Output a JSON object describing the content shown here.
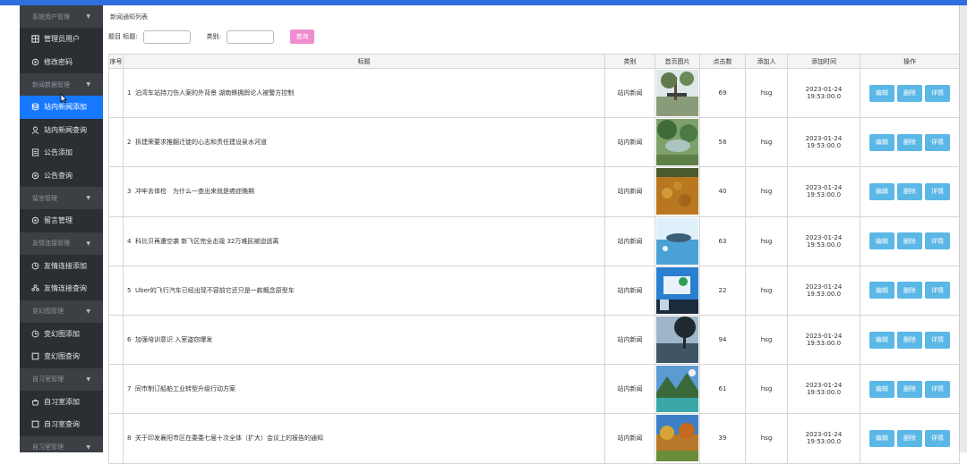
{
  "sidebar": {
    "groups": [
      {
        "header": "系统用户管理",
        "items": [
          {
            "label": "管理员用户",
            "icon": "grid-icon"
          },
          {
            "label": "修改密码",
            "icon": "settings-icon"
          }
        ]
      },
      {
        "header": "新闻数据管理",
        "items": [
          {
            "label": "站内新闻添加",
            "icon": "database-icon",
            "active": true
          },
          {
            "label": "站内新闻查询",
            "icon": "user-icon"
          },
          {
            "label": "公告添加",
            "icon": "document-icon"
          },
          {
            "label": "公告查询",
            "icon": "settings-icon"
          }
        ]
      },
      {
        "header": "留言管理",
        "items": [
          {
            "label": "留言管理",
            "icon": "settings-icon"
          }
        ]
      },
      {
        "header": "友情连接管理",
        "items": [
          {
            "label": "友情连接添加",
            "icon": "clock-icon"
          },
          {
            "label": "友情连接查询",
            "icon": "people-icon"
          }
        ]
      },
      {
        "header": "变幻图管理",
        "items": [
          {
            "label": "变幻图添加",
            "icon": "clock-icon"
          },
          {
            "label": "变幻图查询",
            "icon": "square-icon"
          }
        ]
      },
      {
        "header": "自习室管理",
        "items": [
          {
            "label": "自习室添加",
            "icon": "bag-icon"
          },
          {
            "label": "自习室查询",
            "icon": "square-icon"
          }
        ]
      },
      {
        "header": "自习室管理",
        "items": []
      }
    ]
  },
  "main": {
    "breadcrumb": "新闻通知列表",
    "search": {
      "title_label": "题目 标题:",
      "title_value": "",
      "category_label": "类别:",
      "category_value": "",
      "button": "查询"
    },
    "table": {
      "columns": [
        "序号",
        "标题",
        "类别",
        "首页图片",
        "点击数",
        "添加人",
        "添加时间",
        "操作"
      ],
      "actions": [
        "编辑",
        "删除",
        "详情"
      ],
      "rows": [
        {
          "idx": "1",
          "title": "泊湾车站持刀伤人案的外背景 湖南蜂拥舆论人被警方控制",
          "category": "站内新闻",
          "clicks": "69",
          "author": "hsg",
          "time": "2023-01-24 19:53:00.0"
        },
        {
          "idx": "2",
          "title": "拆建荣要求推翻迁徙的心志和责任建设泉水河道",
          "category": "站内新闻",
          "clicks": "58",
          "author": "hsg",
          "time": "2023-01-24 19:53:00.0"
        },
        {
          "idx": "3",
          "title": "冲牢去体检　为什么一查出来就是癌症晚期",
          "category": "站内新闻",
          "clicks": "40",
          "author": "hsg",
          "time": "2023-01-24 19:53:00.0"
        },
        {
          "idx": "4",
          "title": "科比贝再遭空袭 新飞区完全击毁 32万难民被迫逃离",
          "category": "站内新闻",
          "clicks": "63",
          "author": "hsg",
          "time": "2023-01-24 19:53:00.0"
        },
        {
          "idx": "5",
          "title": "Uber的飞行汽车已经出现不容前它还只是一款概念原型车",
          "category": "站内新闻",
          "clicks": "22",
          "author": "hsg",
          "time": "2023-01-24 19:53:00.0"
        },
        {
          "idx": "6",
          "title": "加强培训意识 入室盗窃爆发",
          "category": "站内新闻",
          "clicks": "94",
          "author": "hsg",
          "time": "2023-01-24 19:53:00.0"
        },
        {
          "idx": "7",
          "title": "同市制订船舶工业转型升级行动方案",
          "category": "站内新闻",
          "clicks": "61",
          "author": "hsg",
          "time": "2023-01-24 19:53:00.0"
        },
        {
          "idx": "8",
          "title": "关于印发襄阳市区在委委七届十次全体（扩大）会议上的报告的通知",
          "category": "站内新闻",
          "clicks": "39",
          "author": "hsg",
          "time": "2023-01-24 19:53:00.0"
        }
      ]
    }
  }
}
